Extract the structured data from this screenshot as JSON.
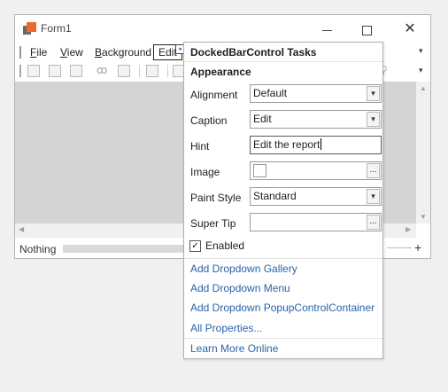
{
  "form": {
    "title": "Form1",
    "window_controls": {
      "minimize": "—",
      "maximize": "☐",
      "close": "✕"
    },
    "menu": [
      "File",
      "View",
      "Background",
      "Edit"
    ],
    "status_text": "Nothing"
  },
  "icons": {
    "app": "form-icon",
    "smart_tag": "◂",
    "dropdown": "▾",
    "ellipsis": "...",
    "check": "✓",
    "plus": "+",
    "scroll_up": "▲",
    "scroll_down": "▼",
    "scroll_left": "◀",
    "scroll_right": "▶",
    "binoculars": "ꝏ",
    "search": "⚲"
  },
  "panel": {
    "title": "DockedBarControl Tasks",
    "section": "Appearance",
    "properties": {
      "alignment": {
        "label": "Alignment",
        "value": "Default"
      },
      "caption": {
        "label": "Caption",
        "value": "Edit"
      },
      "hint": {
        "label": "Hint",
        "value": "Edit the report"
      },
      "image": {
        "label": "Image",
        "value": ""
      },
      "paint_style": {
        "label": "Paint Style",
        "value": "Standard"
      },
      "super_tip": {
        "label": "Super Tip",
        "value": ""
      }
    },
    "enabled": {
      "label": "Enabled",
      "checked": true
    },
    "links": [
      "Add Dropdown Gallery",
      "Add Dropdown Menu",
      "Add Dropdown PopupControlContainer",
      "All Properties...",
      "Learn More Online"
    ]
  },
  "colors": {
    "link": "#2a62ab",
    "app_icon_orange": "#ea6a2e",
    "client_bg": "#d4d4d4"
  }
}
